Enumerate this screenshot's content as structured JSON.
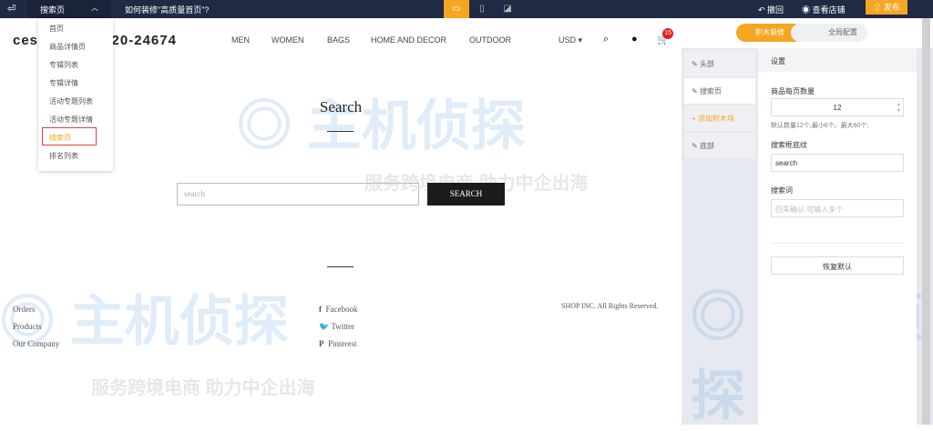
{
  "topbar": {
    "current_page": "搜索页",
    "howto": "如何装修\"高质量首页\"?",
    "undo": "撤回",
    "view_store": "查看店铺",
    "publish": "发布"
  },
  "dropdown": {
    "items": [
      "首页",
      "商品详情页",
      "专辑列表",
      "专辑详情",
      "活动专题列表",
      "活动专题详情",
      "搜索页",
      "排名列表"
    ],
    "selected": "搜索页"
  },
  "store": {
    "logo": "ces",
    "phone": "020-24674",
    "nav": [
      "MEN",
      "WOMEN",
      "BAGS",
      "HOME AND DECOR",
      "OUTDOOR"
    ],
    "currency": "USD",
    "cart_count": "15",
    "search_title": "Search",
    "search_placeholder": "search",
    "search_button": "SEARCH",
    "footer_links": [
      "Orders",
      "Products",
      "Our Company"
    ],
    "social": [
      "Facebook",
      "Twitter",
      "Pinterest"
    ],
    "copyright": "SHOP INC. All Rights Reserved."
  },
  "watermark": {
    "brand": "主机侦探",
    "slogan": "服务跨境电商 助力中企出海"
  },
  "panel": {
    "tabs": [
      "积木装修",
      "全局配置"
    ],
    "sections": [
      "头部",
      "搜索页",
      "添加积木块",
      "底部"
    ],
    "settings_title": "设置",
    "per_page_label": "商品每页数量",
    "per_page_value": "12",
    "per_page_hint": "默认数量12个,最小6个、最大60个;",
    "placeholder_label": "搜索框底纹",
    "placeholder_value": "search",
    "keywords_label": "搜索词",
    "keywords_placeholder": "回车确认,可输入多个",
    "reset": "恢复默认"
  },
  "colors": {
    "accent": "#f5a623",
    "topbar": "#1f2a44"
  }
}
